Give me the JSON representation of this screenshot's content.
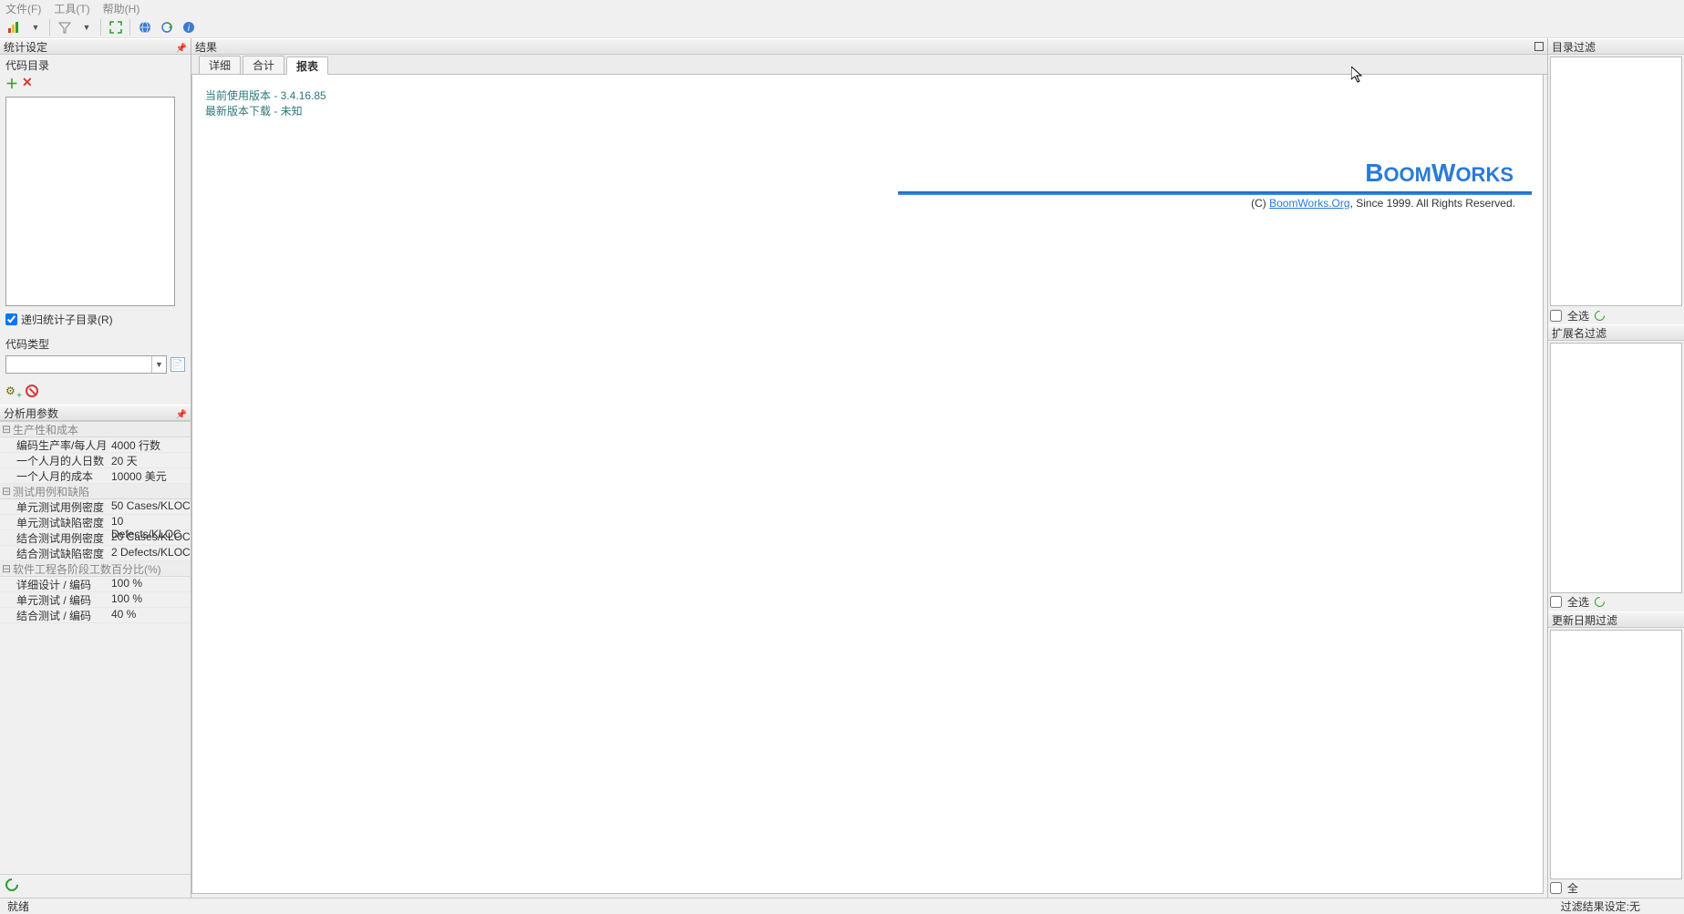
{
  "menu": {
    "file": "文件(F)",
    "tools": "工具(T)",
    "help": "帮助(H)"
  },
  "panels": {
    "stat_settings": "统计设定",
    "code_dir": "代码目录",
    "recursive": "递归统计子目录(R)",
    "code_type": "代码类型",
    "analysis_params": "分析用参数",
    "results": "结果",
    "dir_filter": "目录过滤",
    "ext_filter": "扩展名过滤",
    "date_filter": "更新日期过滤",
    "select_all": "全选",
    "select_all_short": "全"
  },
  "tabs": {
    "detail": "详细",
    "total": "合计",
    "report": "报表"
  },
  "report": {
    "current_version_label": "当前使用版本 - ",
    "current_version_value": "3.4.16.85",
    "latest_version": "最新版本下载 - 未知",
    "logo": "BOOMWORKS",
    "copyright_prefix": "(C) ",
    "copyright_link": "BoomWorks.Org",
    "copyright_suffix": ", Since 1999. All Rights Reserved."
  },
  "params": {
    "groups": [
      {
        "title": "生产性和成本",
        "rows": [
          {
            "k": "编码生产率/每人月",
            "v": "4000 行数"
          },
          {
            "k": "一个人月的人日数",
            "v": "20 天"
          },
          {
            "k": "一个人月的成本",
            "v": "10000 美元"
          }
        ]
      },
      {
        "title": "测试用例和缺陷",
        "rows": [
          {
            "k": "单元测试用例密度",
            "v": "50 Cases/KLOC"
          },
          {
            "k": "单元测试缺陷密度",
            "v": "10 Defects/KLOC"
          },
          {
            "k": "结合测试用例密度",
            "v": "20 Cases/KLOC"
          },
          {
            "k": "结合测试缺陷密度",
            "v": "2 Defects/KLOC"
          }
        ]
      },
      {
        "title": "软件工程各阶段工数百分比(%)",
        "rows": [
          {
            "k": "详细设计 / 编码",
            "v": "100 %"
          },
          {
            "k": "单元测试 / 编码",
            "v": "100 %"
          },
          {
            "k": "结合测试 / 编码",
            "v": "40 %"
          }
        ]
      }
    ]
  },
  "status": {
    "ready": "就绪",
    "filter": "过滤结果设定:无"
  }
}
